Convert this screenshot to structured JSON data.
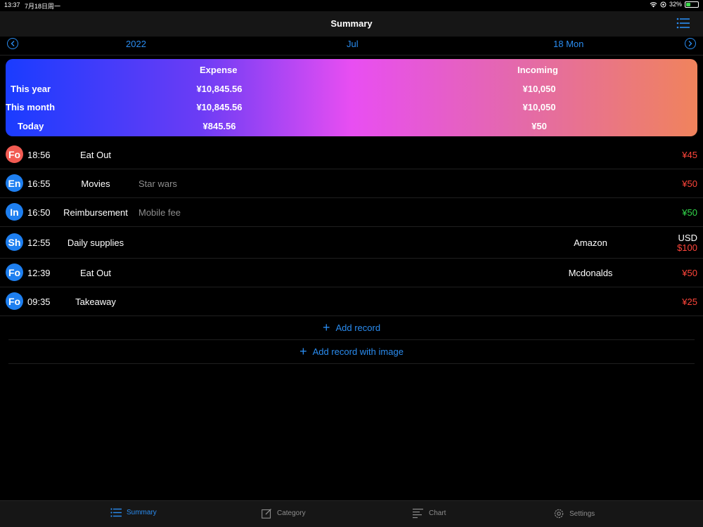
{
  "status_bar": {
    "time": "13:37",
    "date": "7月18日周一",
    "battery": "32%"
  },
  "nav": {
    "title": "Summary"
  },
  "date_nav": {
    "year": "2022",
    "month": "Jul",
    "day": "18 Mon"
  },
  "summary": {
    "headers": {
      "expense": "Expense",
      "incoming": "Incoming"
    },
    "rows": [
      {
        "label": "This year",
        "expense": "¥10,845.56",
        "incoming": "¥10,050"
      },
      {
        "label": "This month",
        "expense": "¥10,845.56",
        "incoming": "¥10,050"
      },
      {
        "label": "Today",
        "expense": "¥845.56",
        "incoming": "¥50"
      }
    ]
  },
  "records": [
    {
      "abbr": "Fo",
      "time": "18:56",
      "category": "Eat Out",
      "note": "",
      "merchant": "",
      "currency": "",
      "amount": "¥45",
      "color": "#f25b52",
      "amount_color": "#ff453a"
    },
    {
      "abbr": "En",
      "time": "16:55",
      "category": "Movies",
      "note": "Star wars",
      "merchant": "",
      "currency": "",
      "amount": "¥50",
      "color": "#1e7ff0",
      "amount_color": "#ff453a"
    },
    {
      "abbr": "In",
      "time": "16:50",
      "category": "Reimbursement",
      "note": "Mobile fee",
      "merchant": "",
      "currency": "",
      "amount": "¥50",
      "color": "#1e7ff0",
      "amount_color": "#32d74b"
    },
    {
      "abbr": "Sh",
      "time": "12:55",
      "category": "Daily supplies",
      "note": "",
      "merchant": "Amazon",
      "currency": "USD",
      "amount": "$100",
      "color": "#1e7ff0",
      "amount_color": "#ff453a"
    },
    {
      "abbr": "Fo",
      "time": "12:39",
      "category": "Eat Out",
      "note": "",
      "merchant": "Mcdonalds",
      "currency": "",
      "amount": "¥50",
      "color": "#1e7ff0",
      "amount_color": "#ff453a"
    },
    {
      "abbr": "Fo",
      "time": "09:35",
      "category": "Takeaway",
      "note": "",
      "merchant": "",
      "currency": "",
      "amount": "¥25",
      "color": "#1e7ff0",
      "amount_color": "#ff453a"
    }
  ],
  "actions": {
    "add_record": "Add record",
    "add_record_image": "Add record with image"
  },
  "tabs": [
    {
      "label": "Summary",
      "icon": "list-icon"
    },
    {
      "label": "Category",
      "icon": "edit-icon"
    },
    {
      "label": "Chart",
      "icon": "chart-icon"
    },
    {
      "label": "Settings",
      "icon": "gear-icon"
    }
  ],
  "colors": {
    "accent": "#2a8cf0",
    "expense": "#ff453a",
    "income": "#32d74b"
  }
}
